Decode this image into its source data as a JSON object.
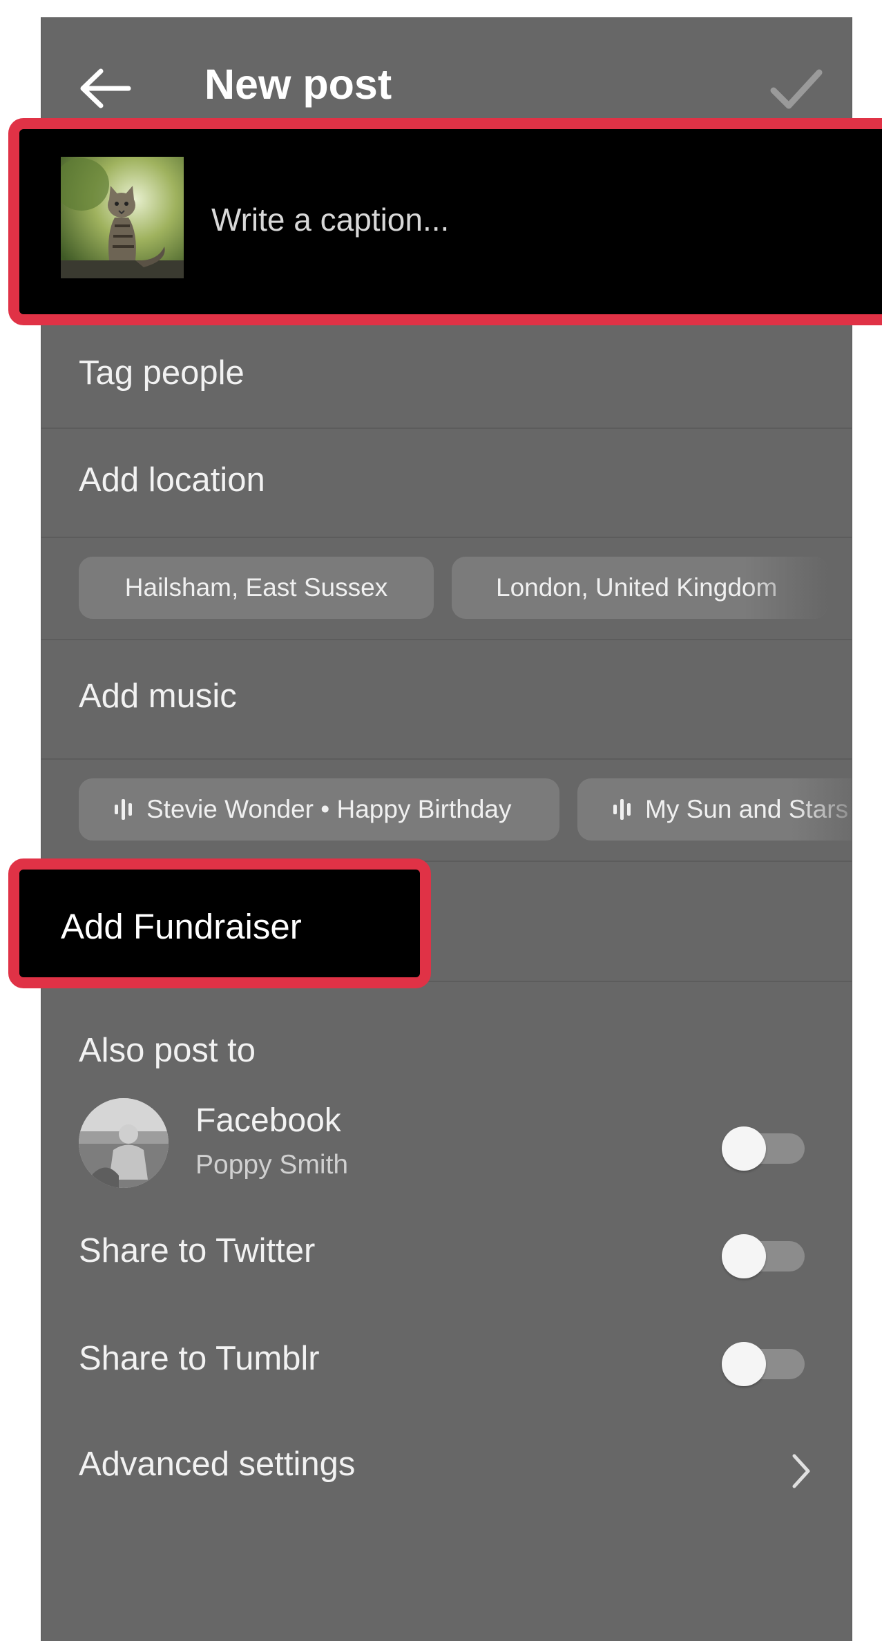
{
  "header": {
    "title": "New post"
  },
  "caption": {
    "placeholder": "Write a caption..."
  },
  "rows": {
    "tag_people": "Tag people",
    "add_location": "Add location",
    "add_music": "Add music",
    "add_fundraiser": "Add Fundraiser"
  },
  "location_chips": [
    "Hailsham, East Sussex",
    "London, United Kingdom"
  ],
  "music_chips": [
    "Stevie Wonder • Happy Birthday",
    "My Sun and Stars"
  ],
  "also_post_to": {
    "heading": "Also post to",
    "facebook": {
      "label": "Facebook",
      "account": "Poppy Smith",
      "enabled": false
    },
    "twitter": {
      "label": "Share to Twitter",
      "enabled": false
    },
    "tumblr": {
      "label": "Share to Tumblr",
      "enabled": false
    }
  },
  "advanced": {
    "label": "Advanced settings"
  },
  "colors": {
    "background": "#676767",
    "highlight": "#e03246",
    "chip": "#7b7b7b"
  },
  "icons": [
    "back-arrow-icon",
    "checkmark-icon",
    "music-bars-icon",
    "chevron-right-icon"
  ]
}
